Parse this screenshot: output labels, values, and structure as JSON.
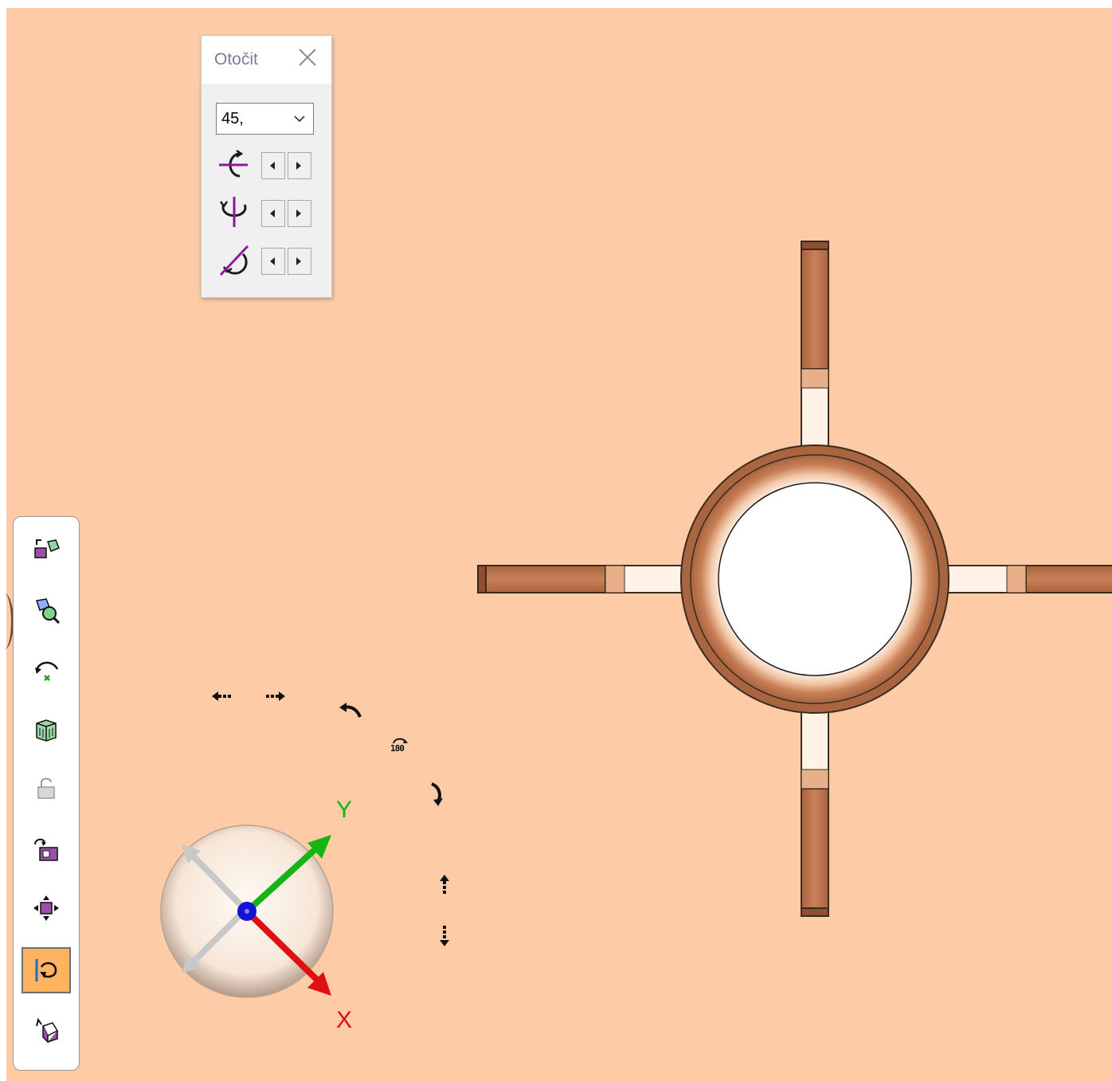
{
  "rotate_dialog": {
    "title": "Otočit",
    "angle_value": "45,",
    "axes": [
      "rotate-x-axis",
      "rotate-y-axis",
      "rotate-z-axis"
    ]
  },
  "triad": {
    "y_label": "Y",
    "x_label": "X"
  },
  "nav_icons": {
    "rotate180_text": "180"
  },
  "toolbar": {
    "items": [
      {
        "name": "view-orientation-icon"
      },
      {
        "name": "zoom-to-selection-icon"
      },
      {
        "name": "rotate-view-icon"
      },
      {
        "name": "display-style-icon"
      },
      {
        "name": "lock-view-icon"
      },
      {
        "name": "save-view-icon"
      },
      {
        "name": "pan-icon"
      },
      {
        "name": "rotate-about-axis-icon",
        "active": true
      },
      {
        "name": "normal-to-icon"
      }
    ]
  },
  "colors": {
    "background": "#fdcca6",
    "model": "#c57c52",
    "accent_active": "#fdb35f",
    "axis_x": "#e01010",
    "axis_y": "#14b414",
    "axis_z": "#1010d0"
  }
}
